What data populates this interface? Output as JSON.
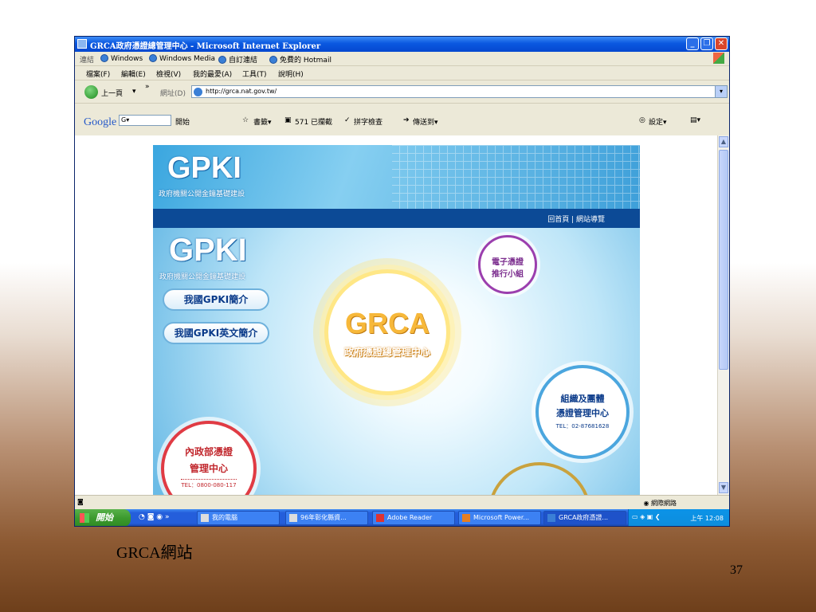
{
  "window": {
    "title": "GRCA政府憑證總管理中心 - Microsoft Internet Explorer",
    "min": "_",
    "max": "❐",
    "close": "✕"
  },
  "links_bar": {
    "label": "連結",
    "items": [
      "Windows",
      "Windows Media",
      "自訂連結",
      "免費的 Hotmail"
    ]
  },
  "menu": [
    "檔案(F)",
    "編輯(E)",
    "檢視(V)",
    "我的最愛(A)",
    "工具(T)",
    "說明(H)"
  ],
  "address_bar": {
    "back": "上一頁",
    "label": "網址(D)",
    "url": "http://grca.nat.gov.tw/"
  },
  "google_bar": {
    "logo": "Google",
    "search_value": "G▾",
    "start": "開始",
    "bookmarks": "書籤▾",
    "blocked": "571 已攔截",
    "spell": "拼字檢查",
    "send": "傳送到▾",
    "settings": "設定▾"
  },
  "site": {
    "header_logo": "GPKI",
    "header_subtitle": "政府機關公開金鑰基礎建設",
    "nav_links": "回首頁 | 網站導覽",
    "main_logo": "GPKI",
    "main_subtitle": "政府機關公開金鑰基礎建設",
    "buttons": [
      "我國GPKI簡介",
      "我國GPKI英文簡介"
    ],
    "center_title": "GRCA",
    "center_subtitle": "政府憑證總管理中心",
    "purple_circle": [
      "電子憑證",
      "推行小組"
    ],
    "blue_circle": [
      "組織及團體",
      "憑證管理中心"
    ],
    "blue_circle_tel": "TEL：02-87681628",
    "red_circle": [
      "內政部憑證",
      "管理中心"
    ],
    "red_circle_tel": "TEL：0800-080-117"
  },
  "status_bar": {
    "zone": "網際網路"
  },
  "taskbar": {
    "start": "開始",
    "tasks": [
      "我的電腦",
      "96年彰化縣資...",
      "Adobe Reader",
      "Microsoft Power...",
      "GRCA政府憑證..."
    ],
    "clock": "上午 12:08"
  },
  "slide": {
    "caption": "GRCA網站",
    "page_number": "37"
  }
}
